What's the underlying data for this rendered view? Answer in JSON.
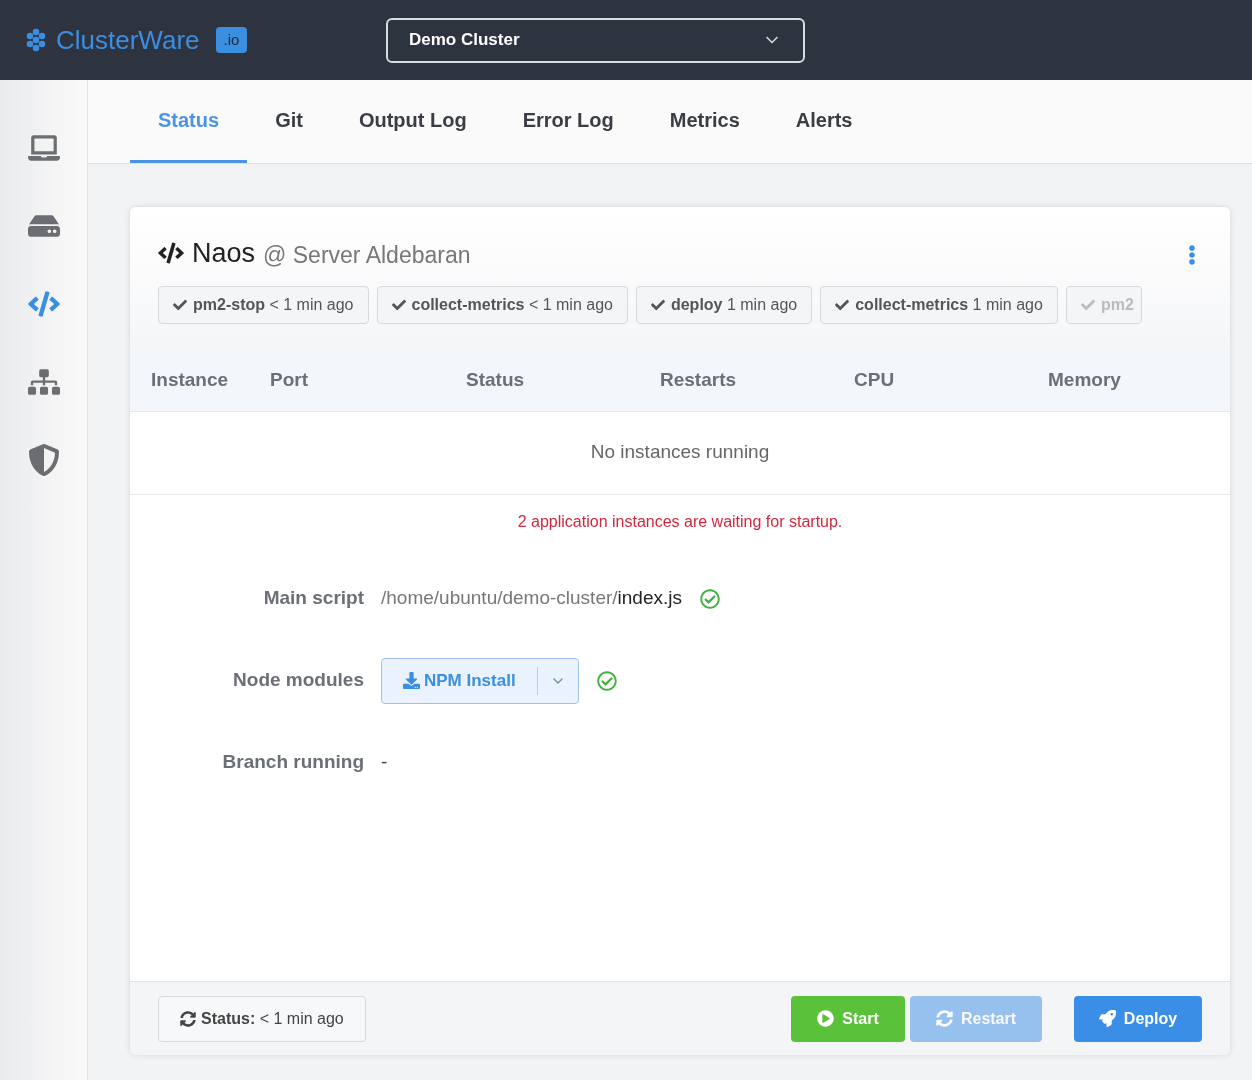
{
  "header": {
    "logo": "ClusterWare",
    "logo_badge": ".io",
    "cluster_select": "Demo Cluster"
  },
  "sidebar": {
    "items": [
      {
        "kind": "laptop",
        "selected": false
      },
      {
        "kind": "drive",
        "selected": false
      },
      {
        "kind": "code",
        "selected": true
      },
      {
        "kind": "sitemap",
        "selected": false
      },
      {
        "kind": "shield",
        "selected": false
      }
    ]
  },
  "tabs": [
    {
      "label": "Status",
      "selected": true
    },
    {
      "label": "Git",
      "selected": false
    },
    {
      "label": "Output Log",
      "selected": false
    },
    {
      "label": "Error Log",
      "selected": false
    },
    {
      "label": "Metrics",
      "selected": false
    },
    {
      "label": "Alerts",
      "selected": false
    }
  ],
  "app": {
    "name": "Naos",
    "server": "@ Server Aldebaran",
    "tasks": [
      {
        "name": "pm2-stop",
        "time": "< 1 min ago"
      },
      {
        "name": "collect-metrics",
        "time": "< 1 min ago"
      },
      {
        "name": "deploy",
        "time": "1 min ago"
      },
      {
        "name": "collect-metrics",
        "time": "1 min ago"
      },
      {
        "name": "pm2"
      }
    ]
  },
  "table": {
    "columns": [
      "Instance",
      "Port",
      "Status",
      "Restarts",
      "CPU",
      "Memory"
    ],
    "empty": "No instances running"
  },
  "warning": "2 application instances are waiting for startup.",
  "details": {
    "main_script_label": "Main script",
    "main_script_dir": "/home/ubuntu/demo-cluster/",
    "main_script_file": "index.js",
    "main_script_ok": true,
    "node_modules_label": "Node modules",
    "npm_button": "NPM Install",
    "node_modules_ok": true,
    "branch_label": "Branch running",
    "branch_value": "-"
  },
  "footer": {
    "status_label": "Status:",
    "status_time": "< 1 min ago",
    "buttons": [
      {
        "kind": "start",
        "label": "Start",
        "disabled": false
      },
      {
        "kind": "restart",
        "label": "Restart",
        "disabled": true
      },
      {
        "kind": "deploy",
        "label": "Deploy",
        "disabled": false
      }
    ]
  }
}
